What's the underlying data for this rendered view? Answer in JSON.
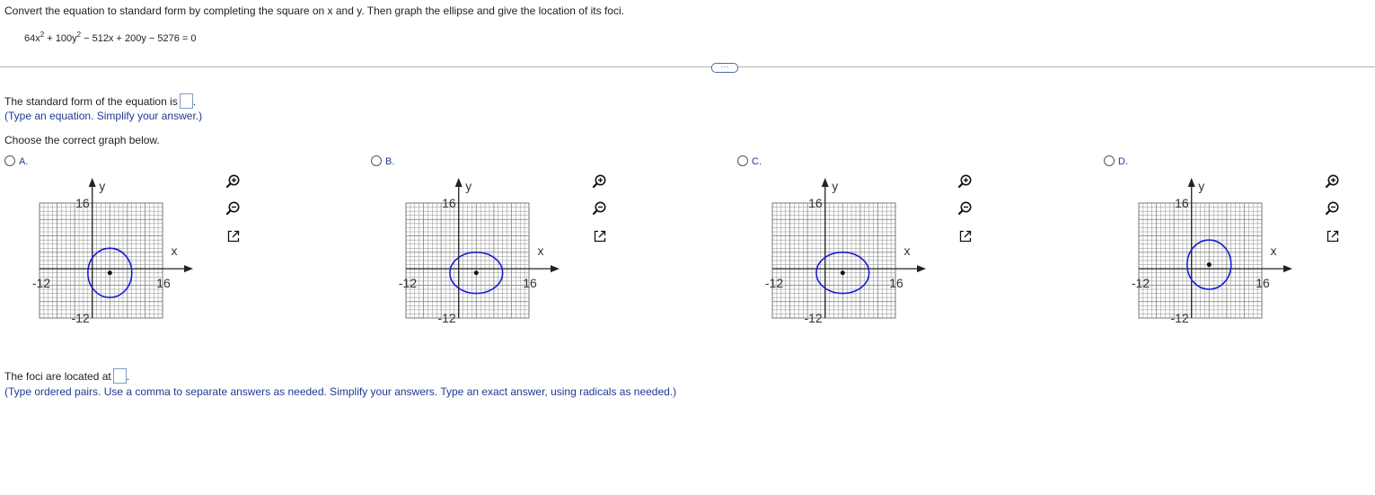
{
  "question": {
    "prompt": "Convert the equation to standard form by completing the square on x and y. Then graph the ellipse and give the location of its foci.",
    "equation_parts": [
      "64x",
      "2",
      " + 100y",
      "2",
      " − 512x + 200y − 5276 = 0"
    ]
  },
  "standard_form": {
    "label": "The standard form of the equation is",
    "hint": "(Type an equation. Simplify your answer.)"
  },
  "graph_choice": {
    "label": "Choose the correct graph below.",
    "options": [
      {
        "letter": "A.",
        "ellipse": {
          "cx": 4,
          "cy": -1,
          "rx": 5,
          "ry": 6
        }
      },
      {
        "letter": "B.",
        "ellipse": {
          "cx": 4,
          "cy": -1,
          "rx": 6,
          "ry": 5
        }
      },
      {
        "letter": "C.",
        "ellipse": {
          "cx": 4,
          "cy": -1,
          "rx": 6,
          "ry": 5
        }
      },
      {
        "letter": "D.",
        "ellipse": {
          "cx": 4,
          "cy": 1,
          "rx": 5,
          "ry": 6
        }
      }
    ],
    "axes": {
      "x_label": "x",
      "y_label": "y",
      "x_min_label": "-12",
      "x_max_label": "16",
      "y_max_label": "16",
      "y_min_label": "-12",
      "xlim": [
        -12,
        16
      ],
      "ylim": [
        -12,
        16
      ],
      "grid": true
    },
    "tools": [
      "zoom-in-icon",
      "zoom-out-icon",
      "open-external-icon"
    ]
  },
  "foci": {
    "label": "The foci are located at",
    "hint": "(Type ordered pairs. Use a comma to separate answers as needed. Simplify your answers. Type an exact answer, using radicals as needed.)"
  },
  "expand_label": "···",
  "colors": {
    "ellipse": "#1a1ad6",
    "hint": "#1f3a93",
    "grid": "#8c8c8c"
  }
}
